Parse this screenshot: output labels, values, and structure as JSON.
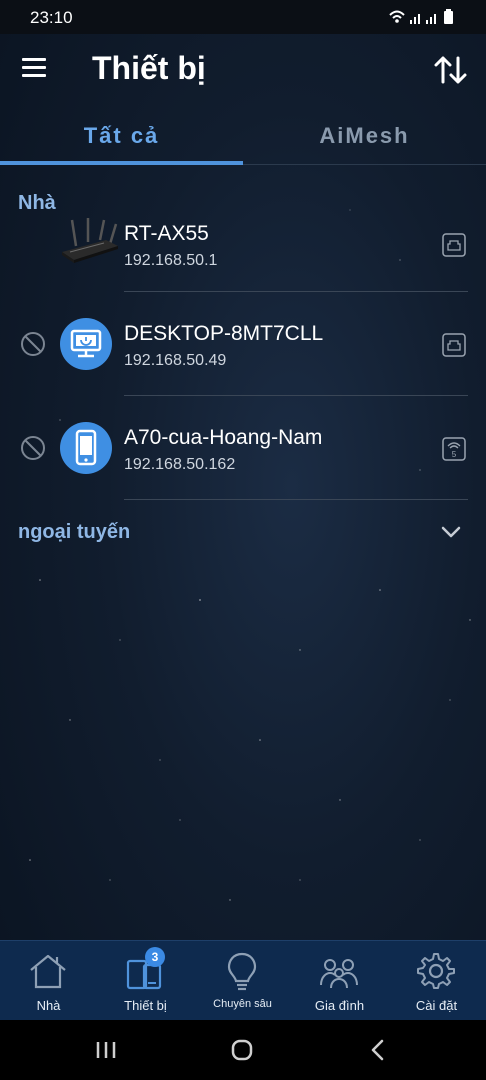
{
  "status_bar": {
    "time": "23:10"
  },
  "header": {
    "title": "Thiết bị",
    "menu_icon": "hamburger-menu-icon",
    "sort_icon": "sort-arrows-icon"
  },
  "tabs": [
    {
      "label": "Tất cả",
      "active": true
    },
    {
      "label": "AiMesh",
      "active": false
    }
  ],
  "section_home": {
    "title": "Nhà"
  },
  "devices": [
    {
      "name": "RT-AX55",
      "ip": "192.168.50.1",
      "icon": "router-icon",
      "connection": "ethernet-port-icon"
    },
    {
      "name": "DESKTOP-8MT7CLL",
      "ip": "192.168.50.49",
      "icon": "desktop-computer-icon",
      "connection": "ethernet-port-icon"
    },
    {
      "name": "A70-cua-Hoang-Nam",
      "ip": "192.168.50.162",
      "icon": "smartphone-icon",
      "connection": "wifi-5ghz-icon"
    }
  ],
  "offline": {
    "label": "ngoại tuyến"
  },
  "bottom_nav": {
    "items": [
      {
        "label": "Nhà",
        "icon": "home-icon"
      },
      {
        "label": "Thiết bị",
        "icon": "devices-icon",
        "badge": "3",
        "active": true
      },
      {
        "label": "Chuyên sâu",
        "icon": "lightbulb-icon"
      },
      {
        "label": "Gia đình",
        "icon": "family-icon"
      },
      {
        "label": "Cài đặt",
        "icon": "gear-icon"
      }
    ]
  },
  "colors": {
    "accent": "#4f93dc",
    "section_title": "#8fb7e5",
    "nav_background": "#0e2a4e",
    "avatar": "#3f8fe3"
  }
}
